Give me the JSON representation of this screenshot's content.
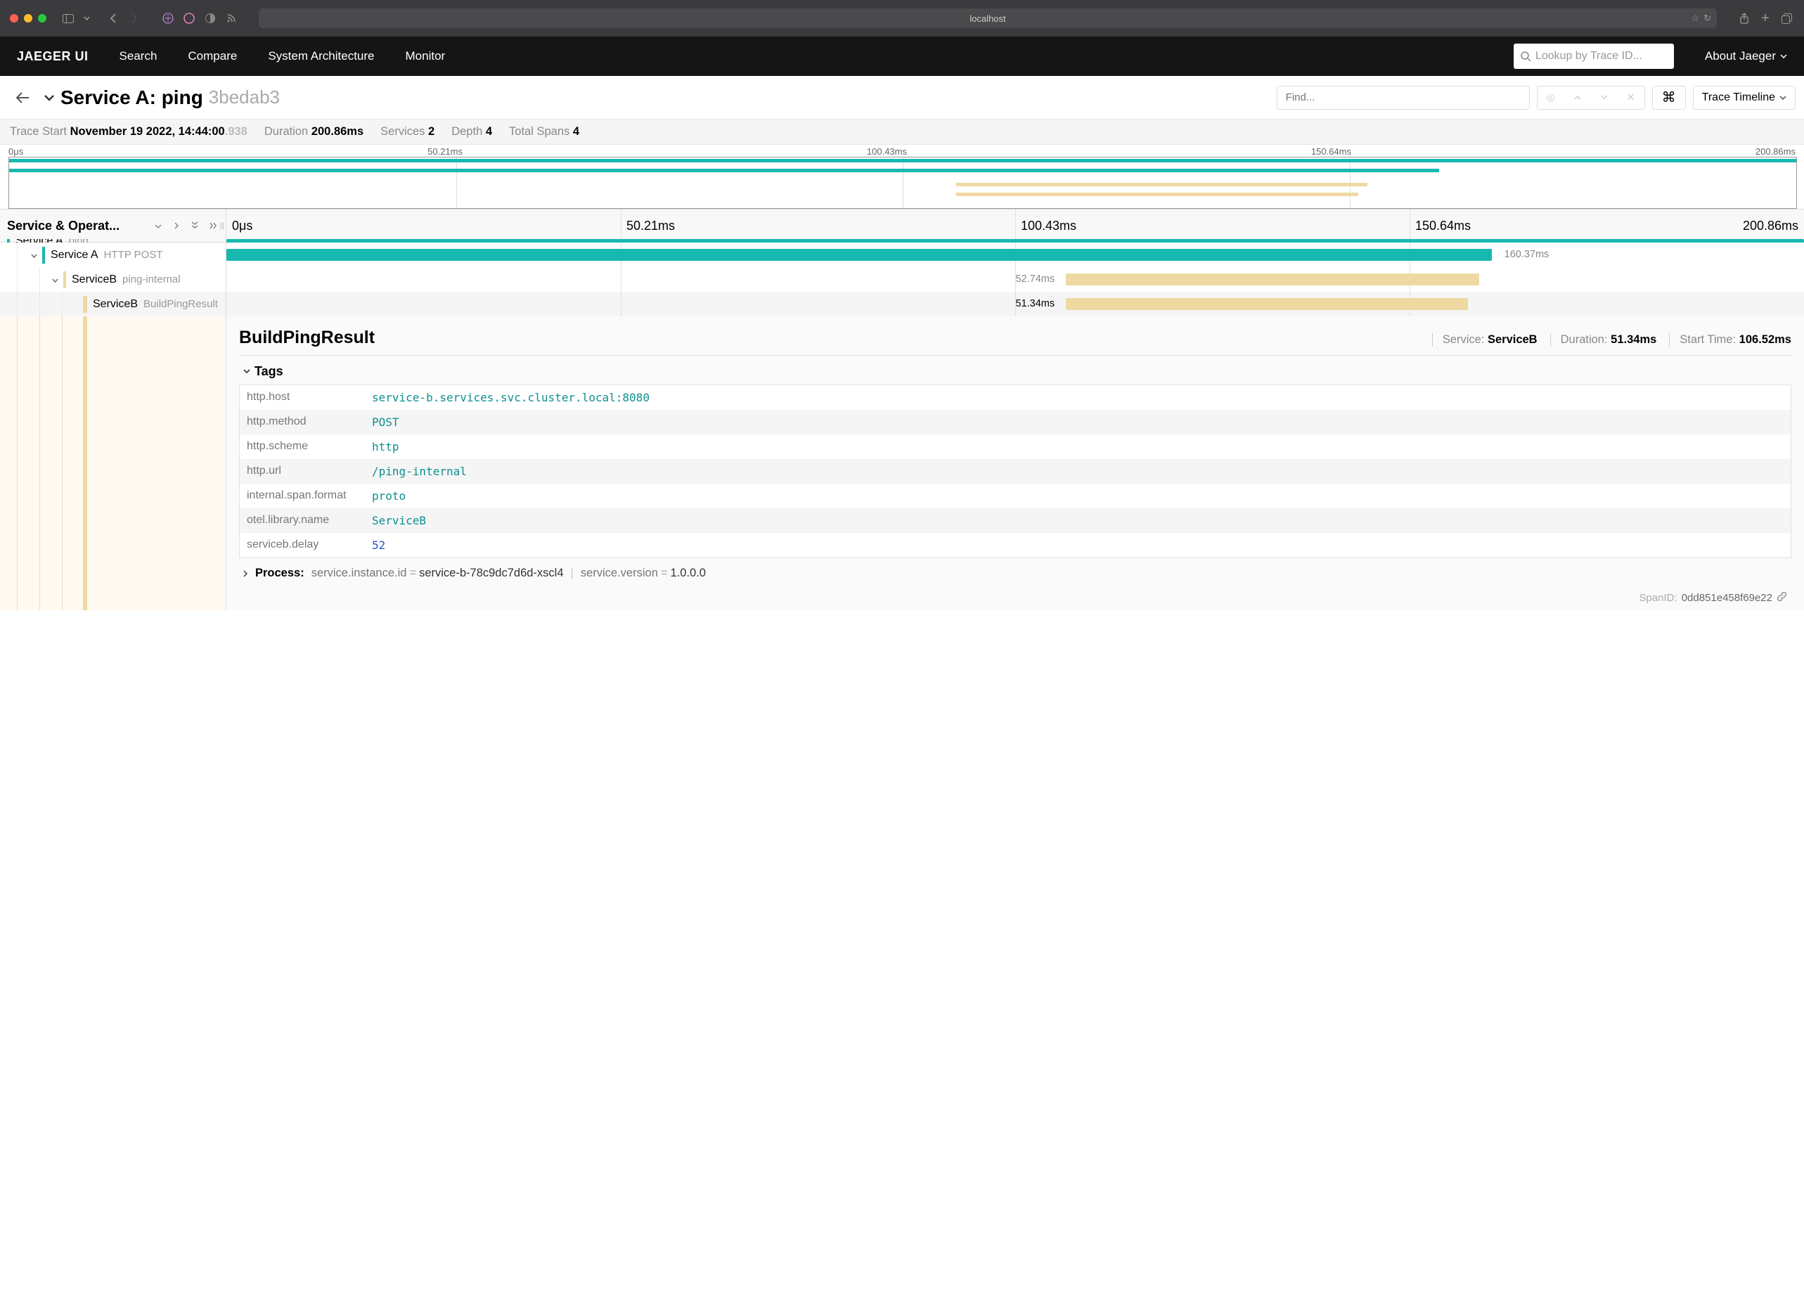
{
  "browser": {
    "url": "localhost"
  },
  "nav": {
    "logo": "JAEGER UI",
    "links": [
      "Search",
      "Compare",
      "System Architecture",
      "Monitor"
    ],
    "lookup_placeholder": "Lookup by Trace ID...",
    "about": "About Jaeger"
  },
  "trace": {
    "title_prefix": "Service A: ping",
    "trace_id": "3bedab3",
    "find_placeholder": "Find...",
    "view_mode": "Trace Timeline"
  },
  "stats": {
    "start_label": "Trace Start",
    "start_value": "November 19 2022, 14:44:00",
    "start_ms": ".938",
    "duration_label": "Duration",
    "duration_value": "200.86ms",
    "services_label": "Services",
    "services_value": "2",
    "depth_label": "Depth",
    "depth_value": "4",
    "spans_label": "Total Spans",
    "spans_value": "4"
  },
  "ticks": [
    "0μs",
    "50.21ms",
    "100.43ms",
    "150.64ms",
    "200.86ms"
  ],
  "columns": {
    "left_title": "Service & Operat..."
  },
  "spans": [
    {
      "service": "Service A",
      "op": "ping",
      "color": "#17b8b0",
      "indent": 0
    },
    {
      "service": "Service A",
      "op": "HTTP POST",
      "color": "#17b8b0",
      "indent": 1,
      "left_pct": 0,
      "width_pct": 80.2,
      "duration": "160.37ms",
      "label_side": "right"
    },
    {
      "service": "ServiceB",
      "op": "ping-internal",
      "color": "#eed9a2",
      "indent": 2,
      "left_pct": 51.6,
      "width_pct": 26.2,
      "duration": "52.74ms",
      "label_side": "left"
    },
    {
      "service": "ServiceB",
      "op": "BuildPingResult",
      "color": "#eed9a2",
      "indent": 3,
      "left_pct": 51.6,
      "width_pct": 25.5,
      "duration": "51.34ms",
      "label_side": "left",
      "selected": true
    }
  ],
  "detail": {
    "op": "BuildPingResult",
    "service_label": "Service:",
    "service": "ServiceB",
    "duration_label": "Duration:",
    "duration": "51.34ms",
    "start_label": "Start Time:",
    "start": "106.52ms",
    "tags_header": "Tags",
    "tags": [
      {
        "k": "http.host",
        "v": "service-b.services.svc.cluster.local:8080",
        "t": "str"
      },
      {
        "k": "http.method",
        "v": "POST",
        "t": "str"
      },
      {
        "k": "http.scheme",
        "v": "http",
        "t": "str"
      },
      {
        "k": "http.url",
        "v": "/ping-internal",
        "t": "str"
      },
      {
        "k": "internal.span.format",
        "v": "proto",
        "t": "str"
      },
      {
        "k": "otel.library.name",
        "v": "ServiceB",
        "t": "str"
      },
      {
        "k": "serviceb.delay",
        "v": "52",
        "t": "num"
      }
    ],
    "process_label": "Process:",
    "process": [
      {
        "k": "service.instance.id",
        "v": "service-b-78c9dc7d6d-xscl4"
      },
      {
        "k": "service.version",
        "v": "1.0.0.0"
      }
    ],
    "span_id_label": "SpanID:",
    "span_id": "0dd851e458f69e22"
  },
  "colors": {
    "serviceA": "#17b8b0",
    "serviceB": "#eed9a2"
  }
}
